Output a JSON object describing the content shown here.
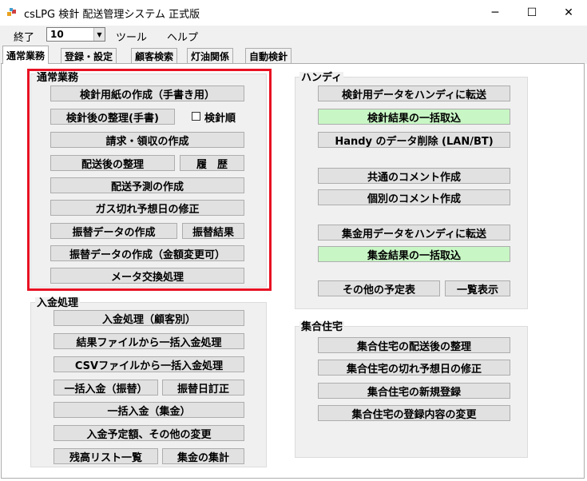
{
  "window": {
    "title": "csLPG 検針 配送管理システム 正式版",
    "minimize": "─",
    "maximize": "☐",
    "close": "✕"
  },
  "menu": {
    "exit": "終了",
    "combo_value": "10",
    "tools": "ツール",
    "help": "ヘルプ"
  },
  "tabs": [
    "通常業務",
    "登録・設定",
    "顧客検索",
    "灯油関係",
    "自動検針"
  ],
  "panels": {
    "normal": {
      "title": "通常業務",
      "btn_form_hand": "検針用紙の作成（手書き用）",
      "btn_after_hand": "検針後の整理(手書)",
      "chk_order": "検針順",
      "btn_billing": "請求・領収の作成",
      "btn_after_delivery": "配送後の整理",
      "btn_history": "履　歴",
      "btn_forecast": "配送予測の作成",
      "btn_gasout_fix": "ガス切れ予想日の修正",
      "btn_transfer_data": "振替データの作成",
      "btn_transfer_result": "振替結果",
      "btn_transfer_amount": "振替データの作成（金額変更可）",
      "btn_meter_exchange": "メータ交換処理"
    },
    "deposit": {
      "title": "入金処理",
      "btn_by_customer": "入金処理（顧客別）",
      "btn_result_file": "結果ファイルから一括入金処理",
      "btn_csv_file": "CSVファイルから一括入金処理",
      "btn_bulk_transfer": "一括入金（振替）",
      "btn_transfer_date_fix": "振替日訂正",
      "btn_bulk_collection": "一括入金（集金）",
      "btn_schedule_change": "入金予定額、その他の変更",
      "btn_balance_list": "残高リスト一覧",
      "btn_collection_total": "集金の集計"
    },
    "handy": {
      "title": "ハンディ",
      "btn_send_meter": "検針用データをハンディに転送",
      "btn_import_meter": "検針結果の一括取込",
      "btn_delete_handy": "Handy のデータ削除 (LAN/BT)",
      "btn_common_comment": "共通のコメント作成",
      "btn_individual_comment": "個別のコメント作成",
      "btn_send_collection": "集金用データをハンディに転送",
      "btn_import_collection": "集金結果の一括取込",
      "btn_other_schedule": "その他の予定表",
      "btn_list_view": "一覧表示"
    },
    "apartment": {
      "title": "集合住宅",
      "btn_after_delivery": "集合住宅の配送後の整理",
      "btn_gasout_fix": "集合住宅の切れ予想日の修正",
      "btn_new_register": "集合住宅の新規登録",
      "btn_change_register": "集合住宅の登録内容の変更"
    }
  },
  "colors": {
    "highlight_frame": "#e81123",
    "green_button": "#c8f7c5"
  }
}
